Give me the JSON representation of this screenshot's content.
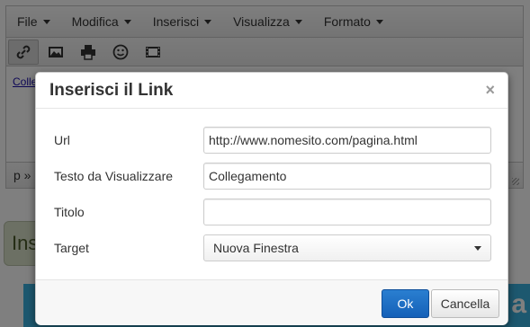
{
  "menubar": {
    "items": [
      "File",
      "Modifica",
      "Inserisci",
      "Visualizza",
      "Formato"
    ]
  },
  "toolbar": {
    "buttons": [
      {
        "icon": "link-icon",
        "active": true
      },
      {
        "icon": "image-icon",
        "active": false
      },
      {
        "icon": "print-icon",
        "active": false
      },
      {
        "icon": "emoticon-icon",
        "active": false
      },
      {
        "icon": "media-icon",
        "active": false
      }
    ]
  },
  "editor": {
    "content_link_text": "Colle",
    "status_path": "p »"
  },
  "background": {
    "badge_text": "Ins",
    "banner_text": "a"
  },
  "modal": {
    "title": "Inserisci il Link",
    "close_symbol": "×",
    "fields": {
      "url": {
        "label": "Url",
        "value": "http://www.nomesito.com/pagina.html"
      },
      "text": {
        "label": "Testo da Visualizzare",
        "value": "Collegamento"
      },
      "title": {
        "label": "Titolo",
        "value": ""
      },
      "target": {
        "label": "Target",
        "value": "Nuova Finestra"
      }
    },
    "buttons": {
      "ok": "Ok",
      "cancel": "Cancella"
    }
  },
  "colors": {
    "primary_button": "#1a6cc4",
    "backdrop": "#000000",
    "link": "#1a0dab"
  }
}
